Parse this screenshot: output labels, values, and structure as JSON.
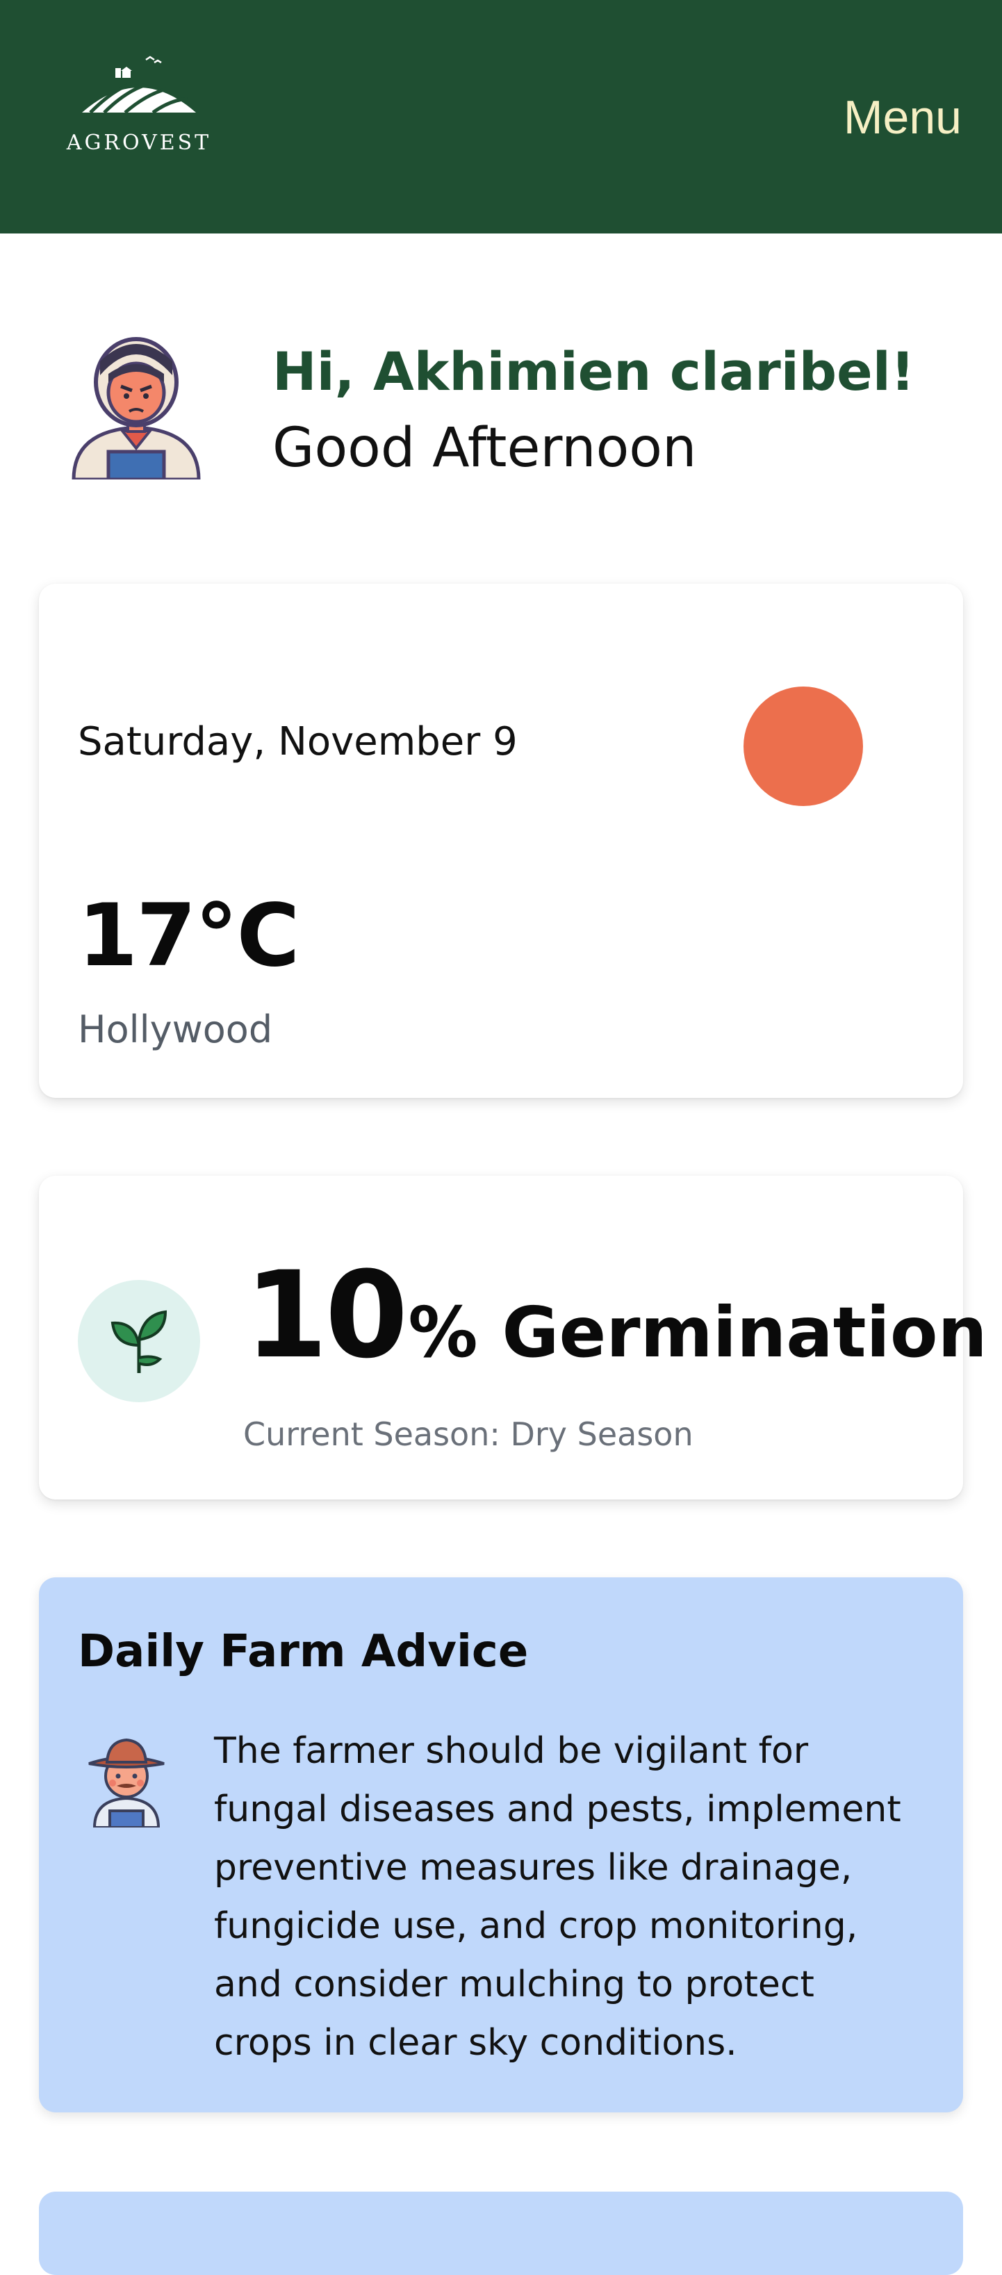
{
  "header": {
    "logo_text": "AGROVEST",
    "menu_label": "Menu"
  },
  "greeting": {
    "hi": "Hi, Akhimien claribel!",
    "salutation": "Good Afternoon"
  },
  "weather": {
    "date": "Saturday, November 9",
    "temperature": "17°C",
    "location": "Hollywood",
    "condition_icon": "sun-icon"
  },
  "germination": {
    "value": "10",
    "label": "% Germination",
    "season": "Current Season: Dry Season",
    "icon": "sprout-icon"
  },
  "advice": {
    "title": "Daily Farm Advice",
    "text": "The farmer should be vigilant for fungal diseases and pests, implement preventive measures like drainage, fungicide use, and crop monitoring, and consider mulching to protect crops in clear sky conditions.",
    "icon": "farmer-icon"
  },
  "colors": {
    "header_bg": "#1f4f32",
    "brand_green": "#1f4f32",
    "menu_text": "#f6efc4",
    "sun": "#ec6f4d",
    "advice_bg": "#c0d8fb",
    "sprout_bg": "#dff2ee"
  }
}
